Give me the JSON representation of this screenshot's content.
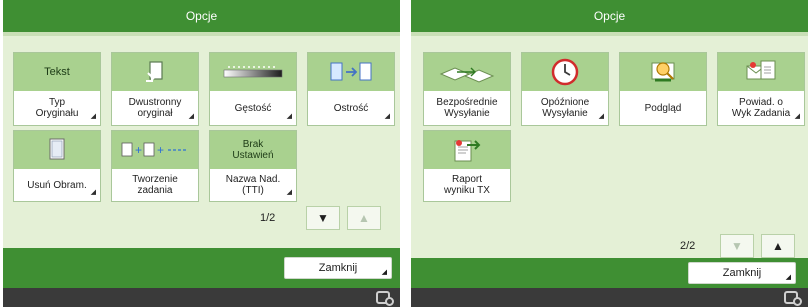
{
  "left_panel": {
    "title": "Opcje",
    "tiles": [
      {
        "top_text": "Tekst",
        "label": "Typ\nOryginału",
        "icon": "text-type-icon",
        "has_corner": true
      },
      {
        "top_text": "",
        "label": "Dwustronny\noryginał",
        "icon": "duplex-original-icon",
        "has_corner": true
      },
      {
        "top_text": "",
        "label": "Gęstość",
        "icon": "density-slider-icon",
        "has_corner": true
      },
      {
        "top_text": "",
        "label": "Ostrość",
        "icon": "sharpness-icon",
        "has_corner": true
      },
      {
        "top_text": "",
        "label": "Usuń Obram.",
        "icon": "erase-frame-icon",
        "has_corner": true
      },
      {
        "top_text": "",
        "label": "Tworzenie\nzadania",
        "icon": "job-build-icon",
        "has_corner": false
      },
      {
        "top_text": "Brak\nUstawień",
        "label": "Nazwa Nad.\n(TTI)",
        "icon": "",
        "has_corner": true
      }
    ],
    "page_indicator": "1/2",
    "down_button_label": "▼",
    "up_button_label": "▲",
    "close_label": "Zamknij"
  },
  "right_panel": {
    "title": "Opcje",
    "tiles": [
      {
        "top_text": "",
        "label": "Bezpośrednie\nWysyłanie",
        "icon": "direct-send-icon",
        "has_corner": false
      },
      {
        "top_text": "",
        "label": "Opóźnione\nWysyłanie",
        "icon": "clock-icon",
        "has_corner": true
      },
      {
        "top_text": "",
        "label": "Podgląd",
        "icon": "preview-icon",
        "has_corner": false
      },
      {
        "top_text": "",
        "label": "Powiad. o\nWyk Zadania",
        "icon": "job-notice-icon",
        "has_corner": true
      },
      {
        "top_text": "",
        "label": "Raport\nwyniku TX",
        "icon": "tx-report-icon",
        "has_corner": false
      }
    ],
    "page_indicator": "2/2",
    "down_button_label": "▼",
    "up_button_label": "▲",
    "close_label": "Zamknij"
  },
  "colors": {
    "title_bar": "#3f8f33",
    "panel_background": "#e4f0d6",
    "tile_top": "#a9d18f",
    "status_bar": "#3a3a3a"
  }
}
